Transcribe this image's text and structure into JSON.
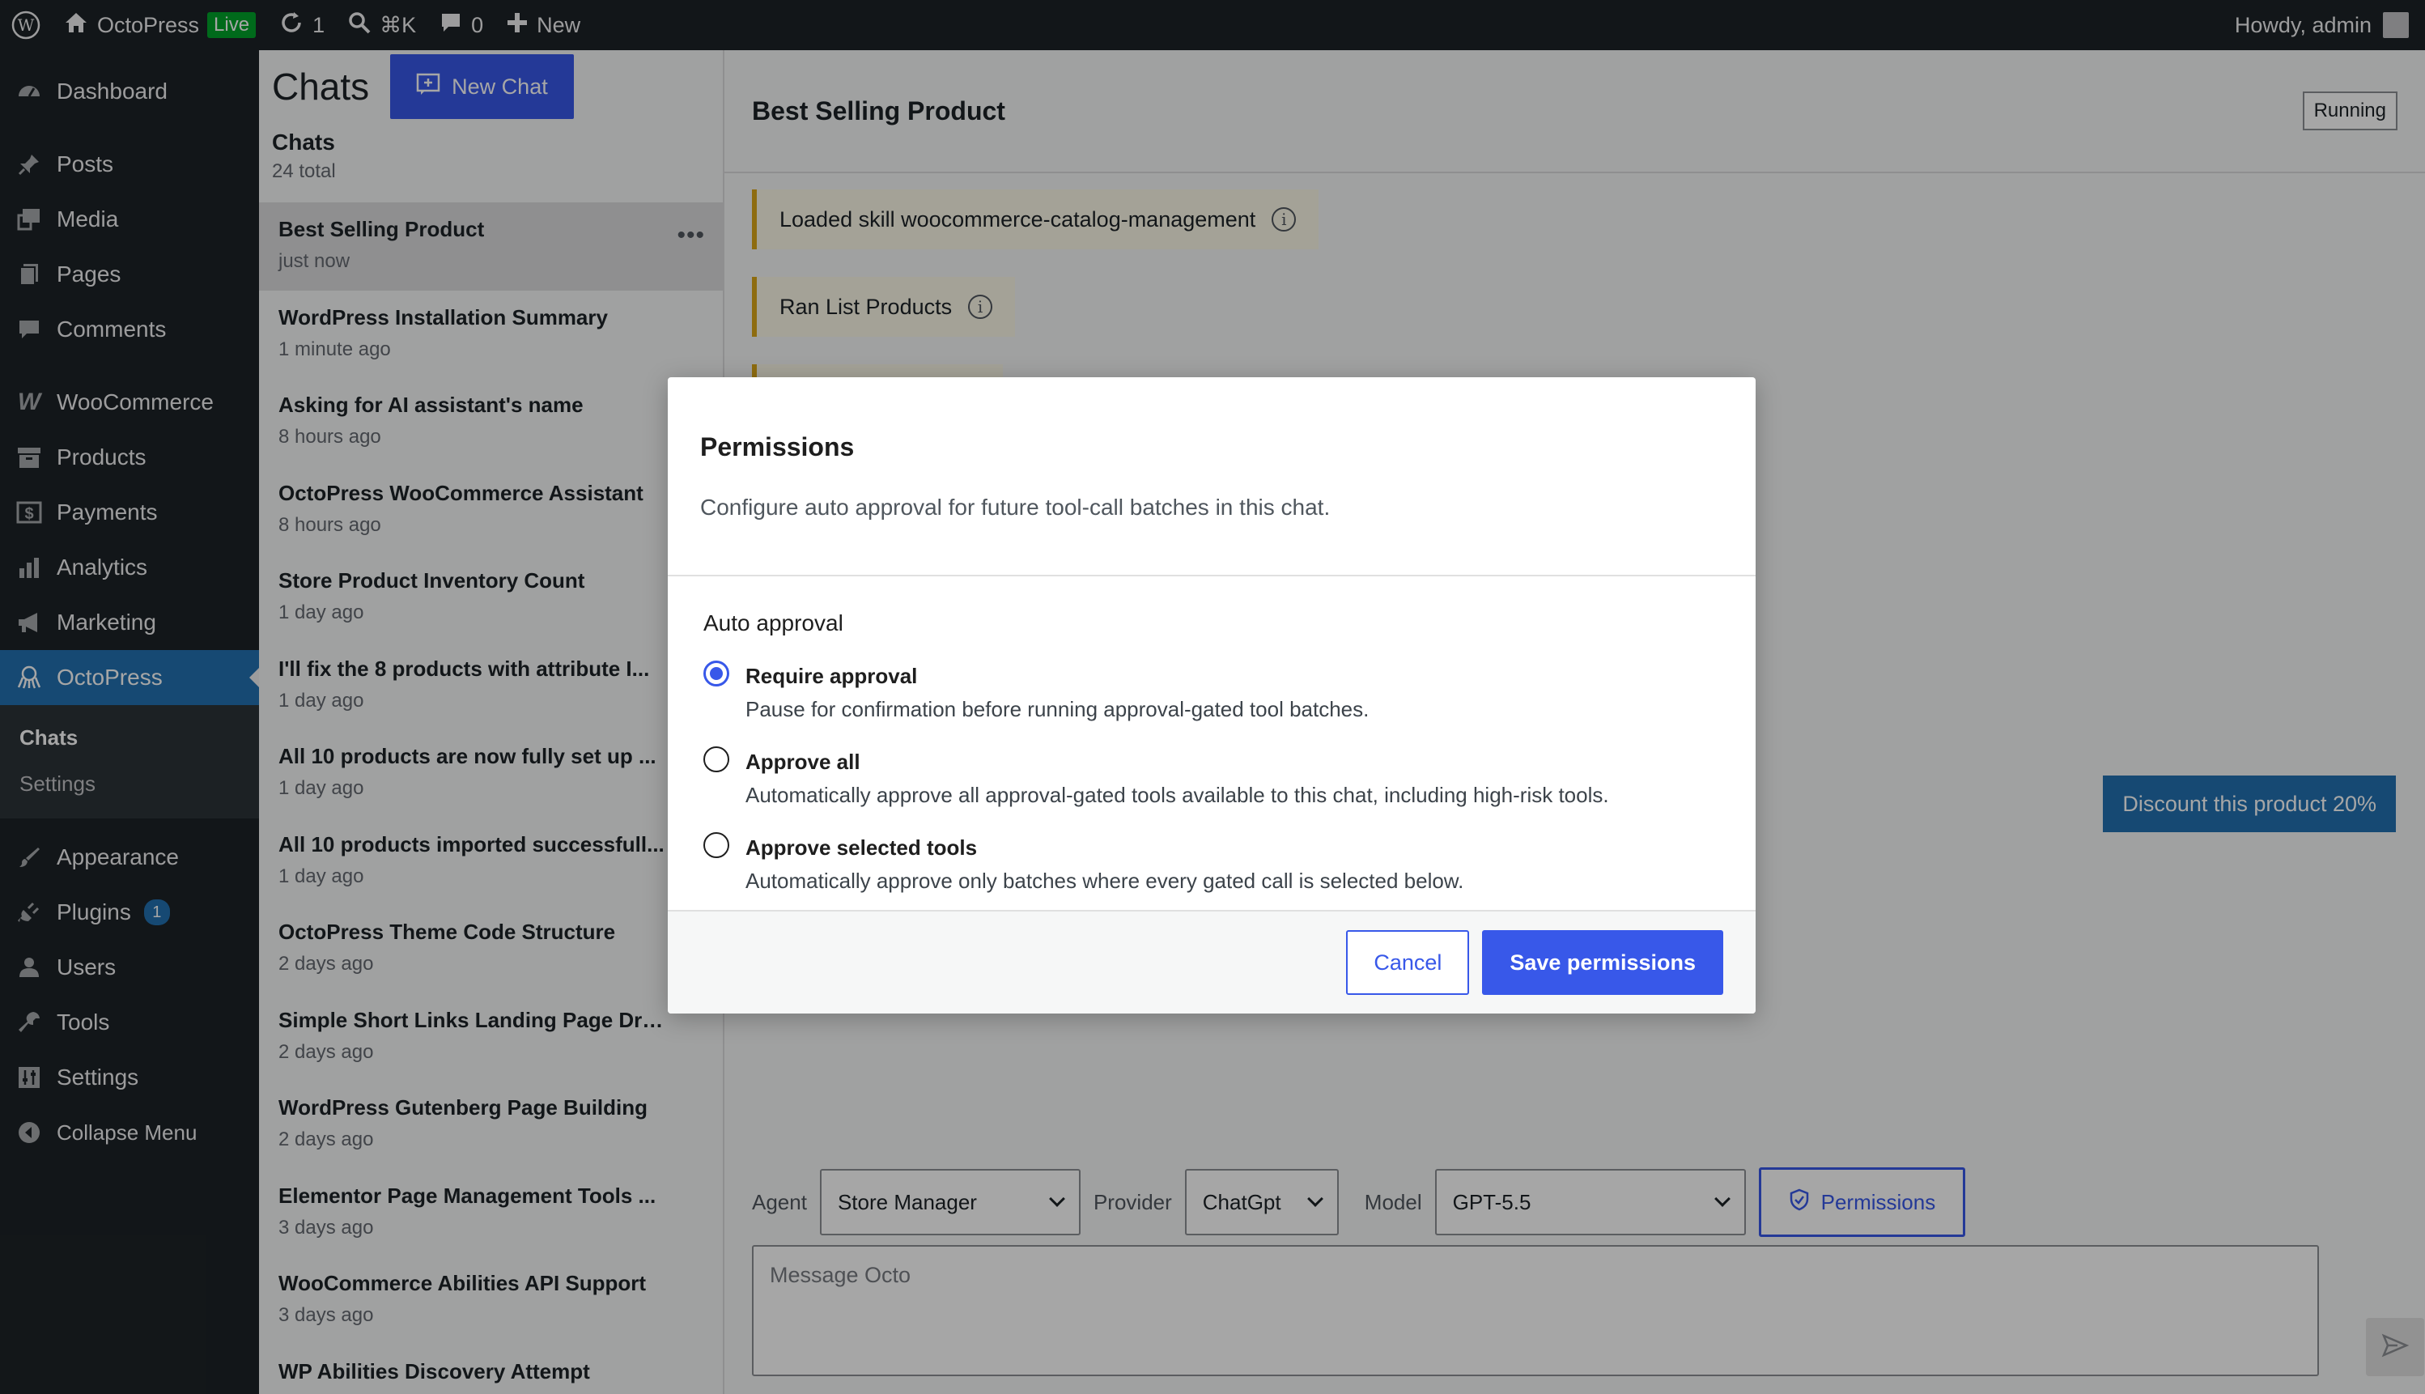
{
  "admin_bar": {
    "site_name": "OctoPress",
    "live_badge": "Live",
    "updates_count": "1",
    "search_shortcut": "⌘K",
    "comments_count": "0",
    "new_label": "New",
    "howdy": "Howdy, admin"
  },
  "admin_menu": {
    "dashboard": "Dashboard",
    "posts": "Posts",
    "media": "Media",
    "pages": "Pages",
    "comments": "Comments",
    "woocommerce": "WooCommerce",
    "products": "Products",
    "payments": "Payments",
    "analytics": "Analytics",
    "marketing": "Marketing",
    "octopress": "OctoPress",
    "sub_chats": "Chats",
    "sub_settings": "Settings",
    "appearance": "Appearance",
    "plugins": "Plugins",
    "plugins_count": "1",
    "users": "Users",
    "tools": "Tools",
    "settings": "Settings",
    "collapse": "Collapse Menu"
  },
  "chats_panel": {
    "heading": "Chats",
    "new_chat": "New Chat",
    "list_title": "Chats",
    "list_count": "24 total",
    "items": [
      {
        "title": "Best Selling Product",
        "time": "just now"
      },
      {
        "title": "WordPress Installation Summary",
        "time": "1 minute ago"
      },
      {
        "title": "Asking for AI assistant's name",
        "time": "8 hours ago"
      },
      {
        "title": "OctoPress WooCommerce Assistant",
        "time": "8 hours ago"
      },
      {
        "title": "Store Product Inventory Count",
        "time": "1 day ago"
      },
      {
        "title": "I'll fix the 8 products with attribute I...",
        "time": "1 day ago"
      },
      {
        "title": "All 10 products are now fully set up ...",
        "time": "1 day ago"
      },
      {
        "title": "All 10 products imported successfull...",
        "time": "1 day ago"
      },
      {
        "title": "OctoPress Theme Code Structure",
        "time": "2 days ago"
      },
      {
        "title": "Simple Short Links Landing Page Draft",
        "time": "2 days ago"
      },
      {
        "title": "WordPress Gutenberg Page Building",
        "time": "2 days ago"
      },
      {
        "title": "Elementor Page Management Tools ...",
        "time": "3 days ago"
      },
      {
        "title": "WooCommerce Abilities API Support",
        "time": "3 days ago"
      },
      {
        "title": "WP Abilities Discovery Attempt",
        "time": ""
      }
    ]
  },
  "main": {
    "title": "Best Selling Product",
    "status": "Running",
    "tool_note_1": "Loaded skill woocommerce-catalog-management",
    "tool_note_2": "Ran List Products",
    "suggestion": "Discount this product 20%",
    "agent_label": "Agent",
    "agent_value": "Store Manager",
    "provider_label": "Provider",
    "provider_value": "ChatGpt",
    "model_label": "Model",
    "model_value": "GPT-5.5",
    "permissions_button": "Permissions",
    "message_placeholder": "Message Octo"
  },
  "modal": {
    "title": "Permissions",
    "description": "Configure auto approval for future tool-call batches in this chat.",
    "group_label": "Auto approval",
    "options": [
      {
        "label": "Require approval",
        "desc": "Pause for confirmation before running approval-gated tool batches."
      },
      {
        "label": "Approve all",
        "desc": "Automatically approve all approval-gated tools available to this chat, including high-risk tools."
      },
      {
        "label": "Approve selected tools",
        "desc": "Automatically approve only batches where every gated call is selected below."
      }
    ],
    "selected_option": "Require approval",
    "cancel": "Cancel",
    "save": "Save permissions"
  }
}
